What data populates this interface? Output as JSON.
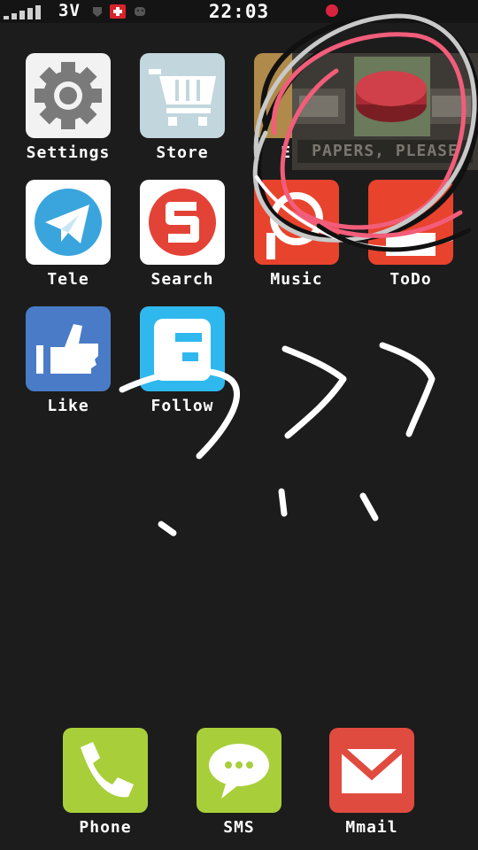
{
  "status_bar": {
    "network": "3V",
    "time": "22:03",
    "signal_bars": 5
  },
  "apps": [
    {
      "label": "Settings",
      "icon": "gear-icon",
      "color": "#f2f2f2"
    },
    {
      "label": "Store",
      "icon": "cart-icon",
      "color": "#c2d6dd"
    },
    {
      "label": "Ent",
      "icon": "entertainment-icon",
      "color": "#b08a4a"
    },
    {
      "label": "Tele",
      "icon": "paper-plane-icon",
      "color": "#ffffff"
    },
    {
      "label": "Search",
      "icon": "search-s-icon",
      "color": "#ffffff"
    },
    {
      "label": "Music",
      "icon": "music-icon",
      "color": "#e8432d"
    },
    {
      "label": "ToDo",
      "icon": "todo-icon",
      "color": "#e8432d"
    },
    {
      "label": "Like",
      "icon": "thumbs-up-icon",
      "color": "#4a7bc6"
    },
    {
      "label": "Follow",
      "icon": "follow-f-icon",
      "color": "#2fb8ee"
    }
  ],
  "banner": {
    "text": "PAPERS, PLEASE"
  },
  "dock": [
    {
      "label": "Phone",
      "icon": "phone-icon",
      "color": "#a8cf3a"
    },
    {
      "label": "SMS",
      "icon": "sms-bubble-icon",
      "color": "#a8cf3a"
    },
    {
      "label": "Mmail",
      "icon": "mail-icon",
      "color": "#e04b3f"
    }
  ]
}
